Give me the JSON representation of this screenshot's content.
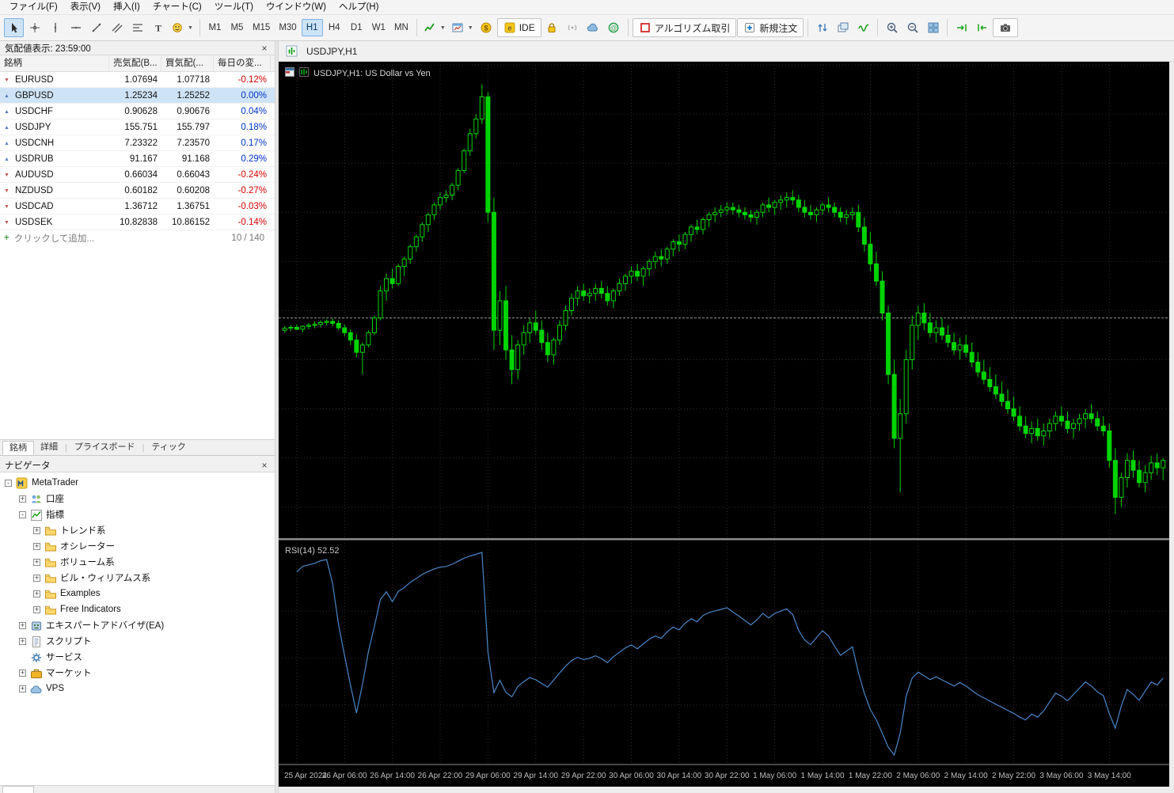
{
  "menu": {
    "items": [
      "ファイル(F)",
      "表示(V)",
      "挿入(I)",
      "チャート(C)",
      "ツール(T)",
      "ウインドウ(W)",
      "ヘルプ(H)"
    ]
  },
  "toolbar": {
    "items": [
      {
        "type": "btn",
        "name": "cursor",
        "active": true
      },
      {
        "type": "btn",
        "name": "crosshair"
      },
      {
        "type": "btn",
        "name": "vertical-line"
      },
      {
        "type": "btn",
        "name": "horizontal-line"
      },
      {
        "type": "btn",
        "name": "trendline"
      },
      {
        "type": "btn",
        "name": "equidistant-channel"
      },
      {
        "type": "btn",
        "name": "fibonacci"
      },
      {
        "type": "btn",
        "name": "text-tool"
      },
      {
        "type": "btn",
        "name": "shapes",
        "dropdown": true
      },
      {
        "type": "sep"
      },
      {
        "type": "tf",
        "label": "M1"
      },
      {
        "type": "tf",
        "label": "M5"
      },
      {
        "type": "tf",
        "label": "M15"
      },
      {
        "type": "tf",
        "label": "M30"
      },
      {
        "type": "tf",
        "label": "H1",
        "active": true
      },
      {
        "type": "tf",
        "label": "H4"
      },
      {
        "type": "tf",
        "label": "D1"
      },
      {
        "type": "tf",
        "label": "W1"
      },
      {
        "type": "tf",
        "label": "MN"
      },
      {
        "type": "sep"
      },
      {
        "type": "btn",
        "name": "indicators",
        "dropdown": true
      },
      {
        "type": "btn",
        "name": "chart-windows",
        "dropdown": true
      },
      {
        "type": "btn",
        "name": "market-watch-toggle"
      },
      {
        "type": "btn",
        "name": "metaeditor",
        "label": "IDE",
        "boxed": true
      },
      {
        "type": "btn",
        "name": "lock"
      },
      {
        "type": "btn",
        "name": "signals"
      },
      {
        "type": "btn",
        "name": "cloud"
      },
      {
        "type": "btn",
        "name": "community"
      },
      {
        "type": "sep"
      },
      {
        "type": "btn",
        "name": "algo-trading",
        "label": "アルゴリズム取引",
        "boxed": true
      },
      {
        "type": "btn",
        "name": "new-order",
        "label": "新規注文",
        "boxed": true
      },
      {
        "type": "sep"
      },
      {
        "type": "btn",
        "name": "depth-of-market"
      },
      {
        "type": "btn",
        "name": "windows-cascade"
      },
      {
        "type": "btn",
        "name": "strategy-tester"
      },
      {
        "type": "sep"
      },
      {
        "type": "btn",
        "name": "zoom-in"
      },
      {
        "type": "btn",
        "name": "zoom-out"
      },
      {
        "type": "btn",
        "name": "tile-windows"
      },
      {
        "type": "sep"
      },
      {
        "type": "btn",
        "name": "chart-shift"
      },
      {
        "type": "btn",
        "name": "auto-scroll"
      },
      {
        "type": "btn",
        "name": "screenshot",
        "boxed": true
      }
    ]
  },
  "market_watch": {
    "title": "気配値表示: 23:59:00",
    "columns": [
      "銘柄",
      "売気配(B...",
      "買気配(...",
      "毎日の変..."
    ],
    "rows": [
      {
        "symbol": "EURUSD",
        "bid": "1.07694",
        "ask": "1.07718",
        "change": "-0.12%"
      },
      {
        "symbol": "GBPUSD",
        "bid": "1.25234",
        "ask": "1.25252",
        "change": "0.00%",
        "selected": true
      },
      {
        "symbol": "USDCHF",
        "bid": "0.90628",
        "ask": "0.90676",
        "change": "0.04%"
      },
      {
        "symbol": "USDJPY",
        "bid": "155.751",
        "ask": "155.797",
        "change": "0.18%"
      },
      {
        "symbol": "USDCNH",
        "bid": "7.23322",
        "ask": "7.23570",
        "change": "0.17%"
      },
      {
        "symbol": "USDRUB",
        "bid": "91.167",
        "ask": "91.168",
        "change": "0.29%"
      },
      {
        "symbol": "AUDUSD",
        "bid": "0.66034",
        "ask": "0.66043",
        "change": "-0.24%"
      },
      {
        "symbol": "NZDUSD",
        "bid": "0.60182",
        "ask": "0.60208",
        "change": "-0.27%"
      },
      {
        "symbol": "USDCAD",
        "bid": "1.36712",
        "ask": "1.36751",
        "change": "-0.03%"
      },
      {
        "symbol": "USDSEK",
        "bid": "10.82838",
        "ask": "10.86152",
        "change": "-0.14%"
      }
    ],
    "add_row_label": "クリックして追加...",
    "count_label": "10 / 140",
    "tabs": [
      "銘柄",
      "詳細",
      "プライスボード",
      "ティック"
    ],
    "active_tab": "銘柄"
  },
  "navigator": {
    "title": "ナビゲータ",
    "tree": [
      {
        "label": "MetaTrader",
        "icon": "mt",
        "depth": 0,
        "expand": "minus"
      },
      {
        "label": "口座",
        "icon": "accounts",
        "depth": 1,
        "expand": "plus"
      },
      {
        "label": "指標",
        "icon": "indicators",
        "depth": 1,
        "expand": "minus"
      },
      {
        "label": "トレンド系",
        "icon": "folder",
        "depth": 2,
        "expand": "plus"
      },
      {
        "label": "オシレーター",
        "icon": "folder",
        "depth": 2,
        "expand": "plus"
      },
      {
        "label": "ボリューム系",
        "icon": "folder",
        "depth": 2,
        "expand": "plus"
      },
      {
        "label": "ビル・ウィリアムス系",
        "icon": "folder",
        "depth": 2,
        "expand": "plus"
      },
      {
        "label": "Examples",
        "icon": "folder",
        "depth": 2,
        "expand": "plus"
      },
      {
        "label": "Free Indicators",
        "icon": "folder",
        "depth": 2,
        "expand": "plus"
      },
      {
        "label": "エキスパートアドバイザ(EA)",
        "icon": "ea",
        "depth": 1,
        "expand": "plus"
      },
      {
        "label": "スクリプト",
        "icon": "scripts",
        "depth": 1,
        "expand": "plus"
      },
      {
        "label": "サービス",
        "icon": "services",
        "depth": 1,
        "expand": "none"
      },
      {
        "label": "マーケット",
        "icon": "market",
        "depth": 1,
        "expand": "plus"
      },
      {
        "label": "VPS",
        "icon": "vps",
        "depth": 1,
        "expand": "plus"
      }
    ]
  },
  "chart": {
    "tab_label": "USDJPY,H1",
    "title": "USDJPY,H1: US Dollar vs Yen",
    "rsi_label": "RSI(14) 52.52"
  },
  "chart_data": {
    "type": "candlestick",
    "symbol": "USDJPY",
    "timeframe": "H1",
    "title": "USDJPY,H1: US Dollar vs Yen",
    "price_range": [
      151.4,
      161.0
    ],
    "bid_line": 155.85,
    "up_color": "#00d400",
    "down_color": "#00d400",
    "bg_color": "#000000",
    "grid_color": "#2d2d2d",
    "rsi": {
      "period": 14,
      "last_value": 52.52,
      "color": "#4a86c8"
    },
    "time_labels": [
      {
        "bar": 2,
        "text": "25 Apr 2024"
      },
      {
        "bar": 10,
        "text": "26 Apr 06:00"
      },
      {
        "bar": 18,
        "text": "26 Apr 14:00"
      },
      {
        "bar": 26,
        "text": "26 Apr 22:00"
      },
      {
        "bar": 34,
        "text": "29 Apr 06:00"
      },
      {
        "bar": 42,
        "text": "29 Apr 14:00"
      },
      {
        "bar": 50,
        "text": "29 Apr 22:00"
      },
      {
        "bar": 58,
        "text": "30 Apr 06:00"
      },
      {
        "bar": 66,
        "text": "30 Apr 14:00"
      },
      {
        "bar": 74,
        "text": "30 Apr 22:00"
      },
      {
        "bar": 82,
        "text": "1 May 06:00"
      },
      {
        "bar": 90,
        "text": "1 May 14:00"
      },
      {
        "bar": 98,
        "text": "1 May 22:00"
      },
      {
        "bar": 106,
        "text": "2 May 06:00"
      },
      {
        "bar": 114,
        "text": "2 May 14:00"
      },
      {
        "bar": 122,
        "text": "2 May 22:00"
      },
      {
        "bar": 130,
        "text": "3 May 06:00"
      },
      {
        "bar": 138,
        "text": "3 May 14:00"
      }
    ],
    "candles_ohlc": [
      [
        155.6,
        155.68,
        155.55,
        155.64
      ],
      [
        155.64,
        155.7,
        155.58,
        155.66
      ],
      [
        155.66,
        155.72,
        155.6,
        155.62
      ],
      [
        155.62,
        155.7,
        155.56,
        155.68
      ],
      [
        155.68,
        155.75,
        155.62,
        155.7
      ],
      [
        155.7,
        155.78,
        155.64,
        155.72
      ],
      [
        155.72,
        155.8,
        155.66,
        155.76
      ],
      [
        155.76,
        155.82,
        155.7,
        155.78
      ],
      [
        155.78,
        155.84,
        155.68,
        155.74
      ],
      [
        155.74,
        155.8,
        155.6,
        155.65
      ],
      [
        155.65,
        155.72,
        155.48,
        155.55
      ],
      [
        155.55,
        155.62,
        155.3,
        155.4
      ],
      [
        155.4,
        155.52,
        155.05,
        155.15
      ],
      [
        155.15,
        155.35,
        154.7,
        155.3
      ],
      [
        155.3,
        155.6,
        155.25,
        155.55
      ],
      [
        155.55,
        155.9,
        155.5,
        155.85
      ],
      [
        155.85,
        156.5,
        155.8,
        156.4
      ],
      [
        156.4,
        156.75,
        156.2,
        156.65
      ],
      [
        156.65,
        156.85,
        156.45,
        156.55
      ],
      [
        156.55,
        156.95,
        156.5,
        156.9
      ],
      [
        156.9,
        157.1,
        156.7,
        157.05
      ],
      [
        157.05,
        157.35,
        156.95,
        157.3
      ],
      [
        157.3,
        157.55,
        157.2,
        157.5
      ],
      [
        157.5,
        157.8,
        157.4,
        157.75
      ],
      [
        157.75,
        158.0,
        157.6,
        157.95
      ],
      [
        157.95,
        158.2,
        157.85,
        158.15
      ],
      [
        158.15,
        158.4,
        158.05,
        158.3
      ],
      [
        158.3,
        158.45,
        158.2,
        158.35
      ],
      [
        158.35,
        158.6,
        158.25,
        158.55
      ],
      [
        158.55,
        158.9,
        158.45,
        158.85
      ],
      [
        158.85,
        159.3,
        158.8,
        159.25
      ],
      [
        159.25,
        159.7,
        159.15,
        159.6
      ],
      [
        159.6,
        160.0,
        159.5,
        159.9
      ],
      [
        159.9,
        160.6,
        159.8,
        160.35
      ],
      [
        160.35,
        160.45,
        157.8,
        158.0
      ],
      [
        158.0,
        158.3,
        155.2,
        155.6
      ],
      [
        155.6,
        156.4,
        155.3,
        156.2
      ],
      [
        156.2,
        156.5,
        155.0,
        155.2
      ],
      [
        155.2,
        155.5,
        154.5,
        154.8
      ],
      [
        154.8,
        155.4,
        154.6,
        155.3
      ],
      [
        155.3,
        155.7,
        155.1,
        155.55
      ],
      [
        155.55,
        155.85,
        155.35,
        155.75
      ],
      [
        155.75,
        156.0,
        155.5,
        155.6
      ],
      [
        155.6,
        155.8,
        155.2,
        155.35
      ],
      [
        155.35,
        155.55,
        154.95,
        155.1
      ],
      [
        155.1,
        155.45,
        154.9,
        155.4
      ],
      [
        155.4,
        155.8,
        155.3,
        155.7
      ],
      [
        155.7,
        156.1,
        155.6,
        156.0
      ],
      [
        156.0,
        156.35,
        155.9,
        156.25
      ],
      [
        156.25,
        156.5,
        156.1,
        156.4
      ],
      [
        156.4,
        156.55,
        156.2,
        156.3
      ],
      [
        156.3,
        156.45,
        156.15,
        156.35
      ],
      [
        156.35,
        156.55,
        156.2,
        156.45
      ],
      [
        156.45,
        156.6,
        156.25,
        156.35
      ],
      [
        156.35,
        156.5,
        156.1,
        156.2
      ],
      [
        156.2,
        156.45,
        156.05,
        156.4
      ],
      [
        156.4,
        156.65,
        156.3,
        156.55
      ],
      [
        156.55,
        156.75,
        156.4,
        156.7
      ],
      [
        156.7,
        156.9,
        156.55,
        156.8
      ],
      [
        156.8,
        156.95,
        156.6,
        156.7
      ],
      [
        156.7,
        156.9,
        156.5,
        156.85
      ],
      [
        156.85,
        157.05,
        156.7,
        157.0
      ],
      [
        157.0,
        157.2,
        156.85,
        157.1
      ],
      [
        157.1,
        157.25,
        156.9,
        157.05
      ],
      [
        157.05,
        157.3,
        156.95,
        157.25
      ],
      [
        157.25,
        157.45,
        157.1,
        157.4
      ],
      [
        157.4,
        157.55,
        157.2,
        157.35
      ],
      [
        157.35,
        157.6,
        157.25,
        157.55
      ],
      [
        157.55,
        157.75,
        157.4,
        157.7
      ],
      [
        157.7,
        157.85,
        157.55,
        157.65
      ],
      [
        157.65,
        157.9,
        157.55,
        157.85
      ],
      [
        157.85,
        158.0,
        157.7,
        157.95
      ],
      [
        157.95,
        158.1,
        157.8,
        158.0
      ],
      [
        158.0,
        158.15,
        157.9,
        158.05
      ],
      [
        158.05,
        158.2,
        157.95,
        158.1
      ],
      [
        158.1,
        158.2,
        157.95,
        158.05
      ],
      [
        158.05,
        158.15,
        157.9,
        158.0
      ],
      [
        158.0,
        158.1,
        157.85,
        157.95
      ],
      [
        157.95,
        158.05,
        157.8,
        157.9
      ],
      [
        157.9,
        158.05,
        157.75,
        158.0
      ],
      [
        158.0,
        158.2,
        157.9,
        158.15
      ],
      [
        158.15,
        158.3,
        158.0,
        158.1
      ],
      [
        158.1,
        158.25,
        157.95,
        158.2
      ],
      [
        158.2,
        158.35,
        158.05,
        158.25
      ],
      [
        158.25,
        158.4,
        158.1,
        158.3
      ],
      [
        158.3,
        158.45,
        158.15,
        158.25
      ],
      [
        158.25,
        158.35,
        158.0,
        158.1
      ],
      [
        158.1,
        158.25,
        157.9,
        158.0
      ],
      [
        158.0,
        158.15,
        157.85,
        157.95
      ],
      [
        157.95,
        158.1,
        157.8,
        158.05
      ],
      [
        158.05,
        158.2,
        157.95,
        158.15
      ],
      [
        158.15,
        158.3,
        158.0,
        158.1
      ],
      [
        158.1,
        158.2,
        157.9,
        158.0
      ],
      [
        158.0,
        158.1,
        157.8,
        157.9
      ],
      [
        157.9,
        158.05,
        157.75,
        157.95
      ],
      [
        157.95,
        158.1,
        157.85,
        158.0
      ],
      [
        158.0,
        158.15,
        157.6,
        157.7
      ],
      [
        157.7,
        157.9,
        157.2,
        157.35
      ],
      [
        157.35,
        157.6,
        156.8,
        156.95
      ],
      [
        156.95,
        157.2,
        156.5,
        156.6
      ],
      [
        156.6,
        156.8,
        155.8,
        155.95
      ],
      [
        155.95,
        156.1,
        154.5,
        154.7
      ],
      [
        154.7,
        155.0,
        153.2,
        153.4
      ],
      [
        153.4,
        154.2,
        152.3,
        153.9
      ],
      [
        153.9,
        155.2,
        153.7,
        155.0
      ],
      [
        155.0,
        155.9,
        154.8,
        155.7
      ],
      [
        155.7,
        156.1,
        155.4,
        155.95
      ],
      [
        155.95,
        156.15,
        155.6,
        155.75
      ],
      [
        155.75,
        155.95,
        155.45,
        155.55
      ],
      [
        155.55,
        155.8,
        155.35,
        155.65
      ],
      [
        155.65,
        155.85,
        155.4,
        155.5
      ],
      [
        155.5,
        155.7,
        155.25,
        155.35
      ],
      [
        155.35,
        155.55,
        155.1,
        155.2
      ],
      [
        155.2,
        155.45,
        155.0,
        155.3
      ],
      [
        155.3,
        155.5,
        155.05,
        155.15
      ],
      [
        155.15,
        155.35,
        154.85,
        154.95
      ],
      [
        154.95,
        155.15,
        154.65,
        154.75
      ],
      [
        154.75,
        155.0,
        154.5,
        154.6
      ],
      [
        154.6,
        154.85,
        154.35,
        154.45
      ],
      [
        154.45,
        154.7,
        154.2,
        154.3
      ],
      [
        154.3,
        154.55,
        154.05,
        154.15
      ],
      [
        154.15,
        154.4,
        153.9,
        154.0
      ],
      [
        154.0,
        154.25,
        153.75,
        153.85
      ],
      [
        153.85,
        154.05,
        153.55,
        153.65
      ],
      [
        153.65,
        153.85,
        153.4,
        153.5
      ],
      [
        153.5,
        153.75,
        153.3,
        153.6
      ],
      [
        153.6,
        153.8,
        153.35,
        153.45
      ],
      [
        153.45,
        153.7,
        153.25,
        153.55
      ],
      [
        153.55,
        153.8,
        153.4,
        153.7
      ],
      [
        153.7,
        153.95,
        153.55,
        153.85
      ],
      [
        153.85,
        154.05,
        153.65,
        153.75
      ],
      [
        153.75,
        153.95,
        153.5,
        153.6
      ],
      [
        153.6,
        153.8,
        153.4,
        153.7
      ],
      [
        153.7,
        153.9,
        153.55,
        153.8
      ],
      [
        153.8,
        154.0,
        153.6,
        153.9
      ],
      [
        153.9,
        154.1,
        153.7,
        153.8
      ],
      [
        153.8,
        153.95,
        153.55,
        153.65
      ],
      [
        153.65,
        153.85,
        153.45,
        153.55
      ],
      [
        153.55,
        153.7,
        152.8,
        152.95
      ],
      [
        152.95,
        153.2,
        151.86,
        152.2
      ],
      [
        152.2,
        152.7,
        152.0,
        152.6
      ],
      [
        152.6,
        153.1,
        152.4,
        152.95
      ],
      [
        152.95,
        153.15,
        152.6,
        152.75
      ],
      [
        152.75,
        152.95,
        152.4,
        152.5
      ],
      [
        152.5,
        152.85,
        152.3,
        152.7
      ],
      [
        152.7,
        153.05,
        152.55,
        152.9
      ],
      [
        152.9,
        153.1,
        152.65,
        152.8
      ],
      [
        152.8,
        153.0,
        152.55,
        152.95
      ]
    ]
  }
}
